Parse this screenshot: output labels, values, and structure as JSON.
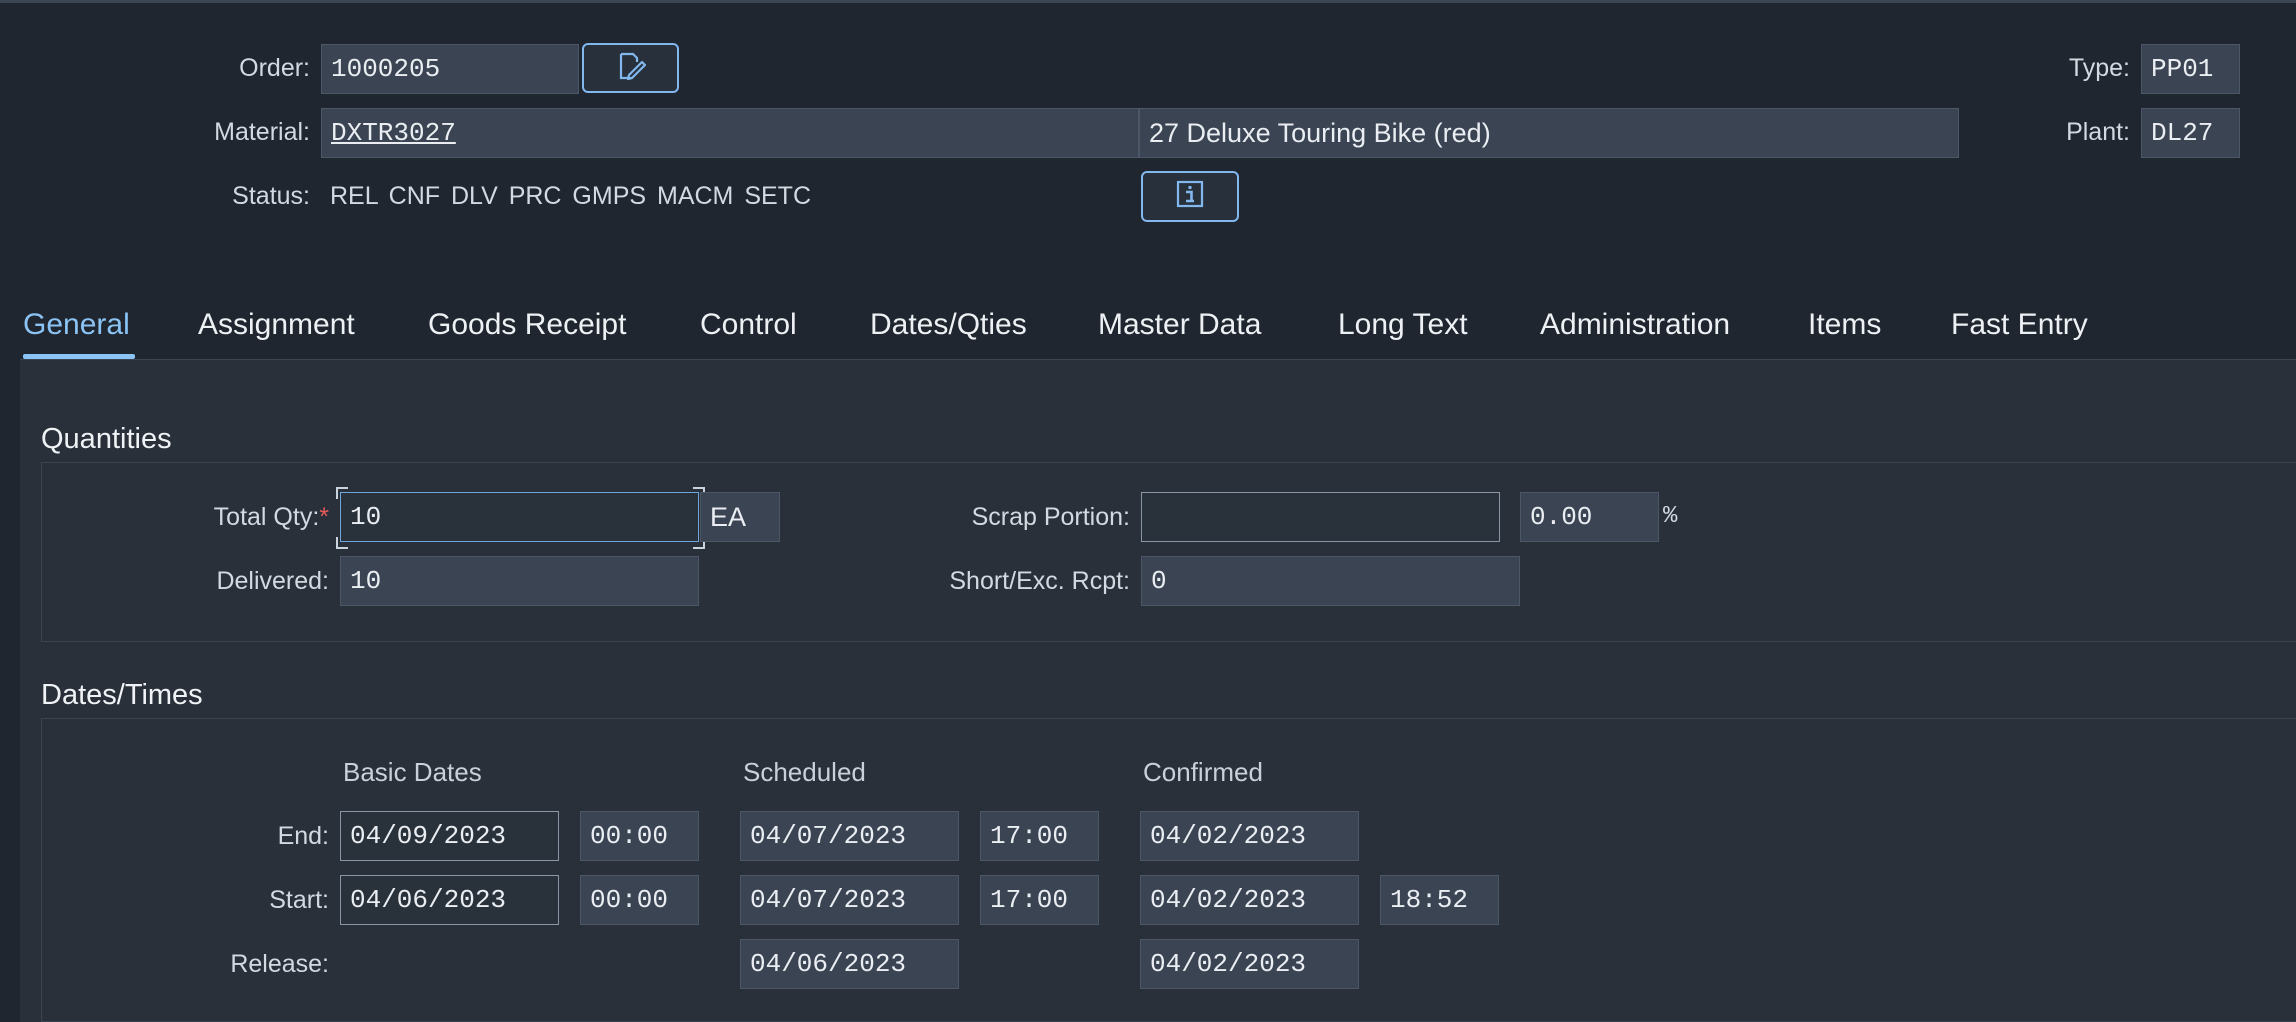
{
  "header": {
    "order_label": "Order:",
    "order_value": "1000205",
    "type_label": "Type:",
    "type_value": "PP01",
    "material_label": "Material:",
    "material_value": "DXTR3027",
    "material_desc": "27 Deluxe Touring Bike (red)",
    "plant_label": "Plant:",
    "plant_value": "DL27",
    "status_label": "Status:",
    "status_value": "REL  CNF  DLV  PRC  GMPS MACM SETC"
  },
  "icons": {
    "edit_button": "edit-document-icon",
    "info_button": "info-icon"
  },
  "tabs": [
    {
      "label": "General",
      "active": true
    },
    {
      "label": "Assignment"
    },
    {
      "label": "Goods Receipt"
    },
    {
      "label": "Control"
    },
    {
      "label": "Dates/Qties"
    },
    {
      "label": "Master Data"
    },
    {
      "label": "Long Text"
    },
    {
      "label": "Administration"
    },
    {
      "label": "Items"
    },
    {
      "label": "Fast Entry"
    }
  ],
  "quantities": {
    "title": "Quantities",
    "total_qty_label": "Total Qty:",
    "required_mark": "*",
    "total_qty_value": "10",
    "total_qty_unit": "EA",
    "delivered_label": "Delivered:",
    "delivered_value": "10",
    "scrap_label": "Scrap Portion:",
    "scrap_value": "",
    "scrap_percent": "0.00",
    "percent_sign": "%",
    "short_label": "Short/Exc. Rcpt:",
    "short_value": "0"
  },
  "dates": {
    "title": "Dates/Times",
    "col_basic": "Basic Dates",
    "col_scheduled": "Scheduled",
    "col_confirmed": "Confirmed",
    "end_label": "End:",
    "start_label": "Start:",
    "release_label": "Release:",
    "end": {
      "basic_date": "04/09/2023",
      "basic_time": "00:00",
      "sched_date": "04/07/2023",
      "sched_time": "17:00",
      "conf_date": "04/02/2023"
    },
    "start": {
      "basic_date": "04/06/2023",
      "basic_time": "00:00",
      "sched_date": "04/07/2023",
      "sched_time": "17:00",
      "conf_date": "04/02/2023",
      "conf_time": "18:52"
    },
    "release": {
      "sched_date": "04/06/2023",
      "conf_date": "04/02/2023"
    }
  },
  "colors": {
    "background": "#1f2630",
    "accent": "#8bc4f4",
    "required": "#e65a5a"
  }
}
